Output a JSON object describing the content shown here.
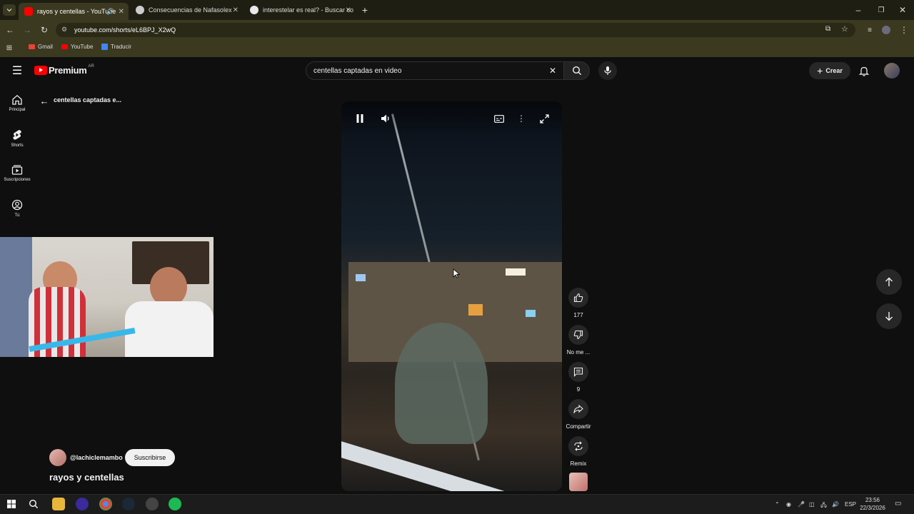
{
  "browser": {
    "tabs": [
      {
        "title": "rayos y centellas - YouTube",
        "active": true
      },
      {
        "title": "Consecuencias de Nafasolex",
        "active": false
      },
      {
        "title": "interestelar es real? - Buscar co",
        "active": false
      }
    ],
    "url": "youtube.com/shorts/eL6BPJ_X2wQ",
    "bookmarks": [
      "Gmail",
      "YouTube",
      "Traducir"
    ]
  },
  "youtube": {
    "logo_text": "Premium",
    "logo_region": "AR",
    "search_value": "centellas captadas en video",
    "create_label": "Crear",
    "sidebar": [
      {
        "label": "Principal",
        "icon": "home-icon"
      },
      {
        "label": "Shorts",
        "icon": "shorts-icon"
      },
      {
        "label": "Suscripciones",
        "icon": "subscriptions-icon"
      },
      {
        "label": "Tú",
        "icon": "you-icon"
      }
    ],
    "back_title": "centellas captadas e...",
    "channel": "@lachiclemambo",
    "subscribe_label": "Suscribirse",
    "video_title": "rayos y centellas",
    "actions": {
      "like_count": "177",
      "dislike_label": "No me ...",
      "comments_count": "9",
      "share_label": "Compartir",
      "remix_label": "Remix"
    }
  },
  "taskbar": {
    "language": "ESP",
    "time": "23:56",
    "date": "22/3/2026"
  },
  "colors": {
    "browser_frame": "#3b3920",
    "tab_strip": "#1f1e12",
    "youtube_bg": "#0f0f0f",
    "youtube_red": "#ff0000"
  }
}
